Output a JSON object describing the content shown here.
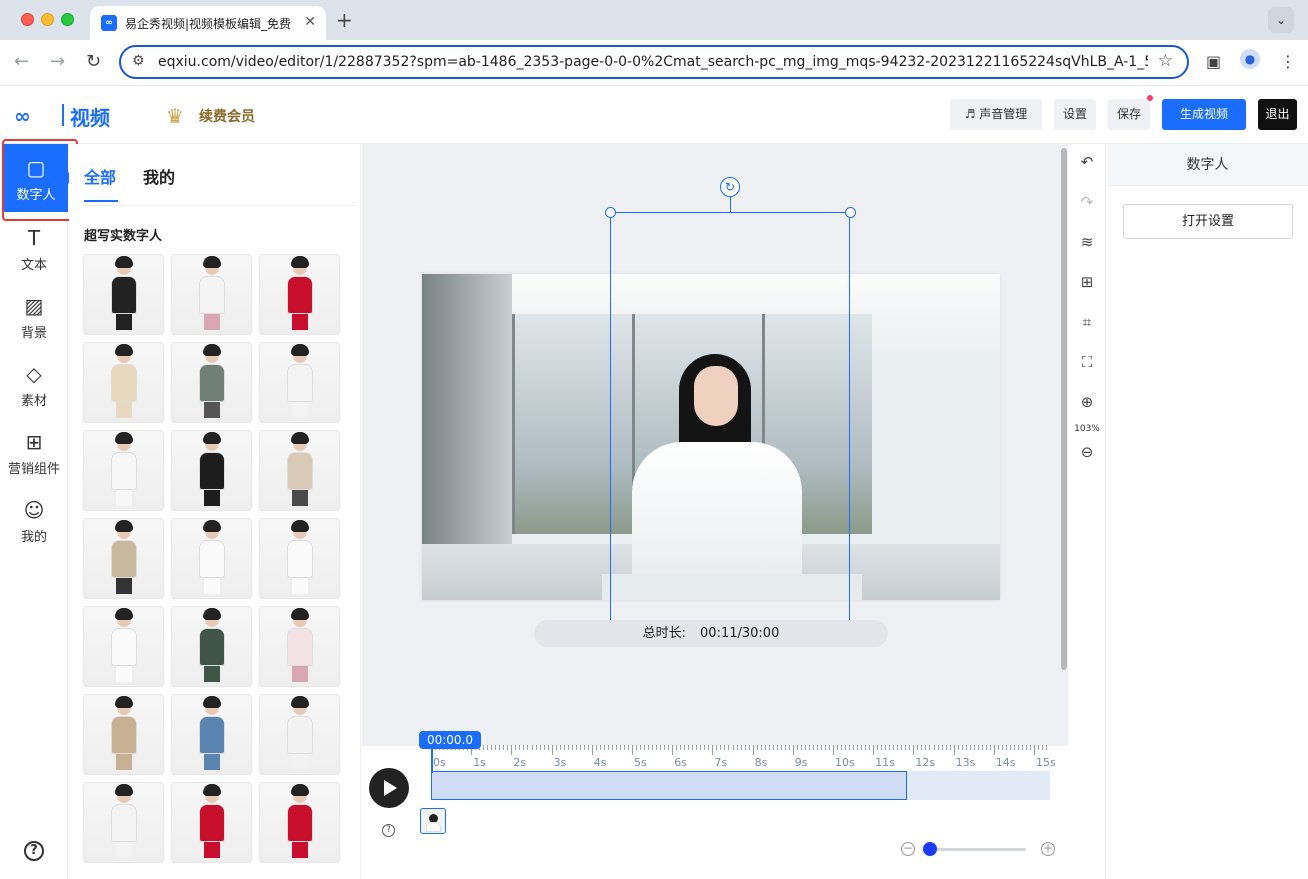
{
  "browser": {
    "tab_title": "易企秀视频|视频模板编辑_免费",
    "url": "eqxiu.com/video/editor/1/22887352?spm=ab-1486_2353-page-0-0-0%2Cmat_search-pc_mg_img_mqs-94232-20231221165224sqVhLB_A-1_50-..."
  },
  "header": {
    "logo_mark": "∞",
    "logo_text": "视频",
    "vip_label": "续费会员",
    "voice_button": "♬ 声音管理",
    "settings_button": "设置",
    "save_button": "保存",
    "generate_button": "生成视频",
    "exit_button": "退出"
  },
  "rail": {
    "items": [
      {
        "label": "数字人",
        "icon": "avatar-icon"
      },
      {
        "label": "文本",
        "icon": "text-icon"
      },
      {
        "label": "背景",
        "icon": "background-icon"
      },
      {
        "label": "素材",
        "icon": "material-icon"
      },
      {
        "label": "营销组件",
        "icon": "marketing-icon"
      },
      {
        "label": "我的",
        "icon": "user-icon"
      }
    ],
    "help": "?"
  },
  "asset_panel": {
    "tab_all": "全部",
    "tab_mine": "我的",
    "section_title": "超写实数字人"
  },
  "canvas": {
    "duration_label": "总时长:",
    "duration_value": "00:11/30:00"
  },
  "tools": {
    "zoom_percent": "103%"
  },
  "properties": {
    "title": "数字人",
    "open_settings": "打开设置"
  },
  "timeline": {
    "playhead": "00:00.0",
    "ticks": [
      "0s",
      "1s",
      "2s",
      "3s",
      "4s",
      "5s",
      "6s",
      "7s",
      "8s",
      "9s",
      "10s",
      "11s",
      "12s",
      "13s",
      "14s",
      "15s"
    ],
    "help": "?"
  },
  "colors": {
    "accent": "#1a6dff",
    "highlight": "#e53935"
  }
}
